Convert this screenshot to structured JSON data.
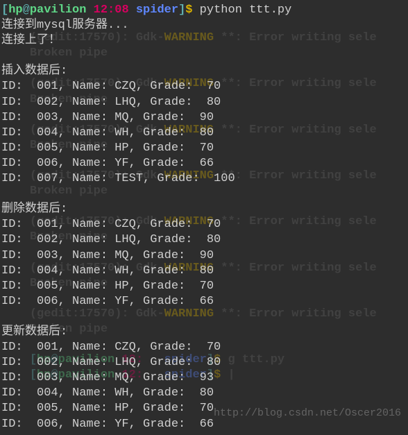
{
  "prompt": {
    "bracket_open": "[",
    "user": "hp",
    "at": "@",
    "host": "pavilion",
    "time": "12:08",
    "dir": "spider",
    "bracket_close": "]",
    "dollar": "$"
  },
  "command": " python ttt.py",
  "msg_connecting": "连接到mysql服务器...",
  "msg_connected": "连接上了！",
  "section_insert": "插入数据后:",
  "section_delete": "删除数据后:",
  "section_update": "更新数据后:",
  "rows_insert": [
    "ID:  001, Name: CZQ, Grade:  70",
    "ID:  002, Name: LHQ, Grade:  80",
    "ID:  003, Name: MQ, Grade:  90",
    "ID:  004, Name: WH, Grade:  80",
    "ID:  005, Name: HP, Grade:  70",
    "ID:  006, Name: YF, Grade:  66",
    "ID:  007, Name: TEST, Grade:  100"
  ],
  "rows_delete": [
    "ID:  001, Name: CZQ, Grade:  70",
    "ID:  002, Name: LHQ, Grade:  80",
    "ID:  003, Name: MQ, Grade:  90",
    "ID:  004, Name: WH, Grade:  80",
    "ID:  005, Name: HP, Grade:  70",
    "ID:  006, Name: YF, Grade:  66"
  ],
  "rows_update": [
    "ID:  001, Name: CZQ, Grade:  70",
    "ID:  002, Name: LHQ, Grade:  80",
    "ID:  003, Name: MQ, Grade:  93",
    "ID:  004, Name: WH, Grade:  80",
    "ID:  005, Name: HP, Grade:  70",
    "ID:  006, Name: YF, Grade:  66"
  ],
  "bg": {
    "warn_prefix": "(gedit:17570): Gdk-",
    "warn_label": "WARNING",
    "warn_suffix": " **: Error writing sele",
    "broken_pipe": "Broken pipe",
    "prompt2_time": "12:",
    "prompt2_cmd": "g ttt.py",
    "cursor": "|"
  },
  "watermark": "http://blog.csdn.net/Oscer2016"
}
